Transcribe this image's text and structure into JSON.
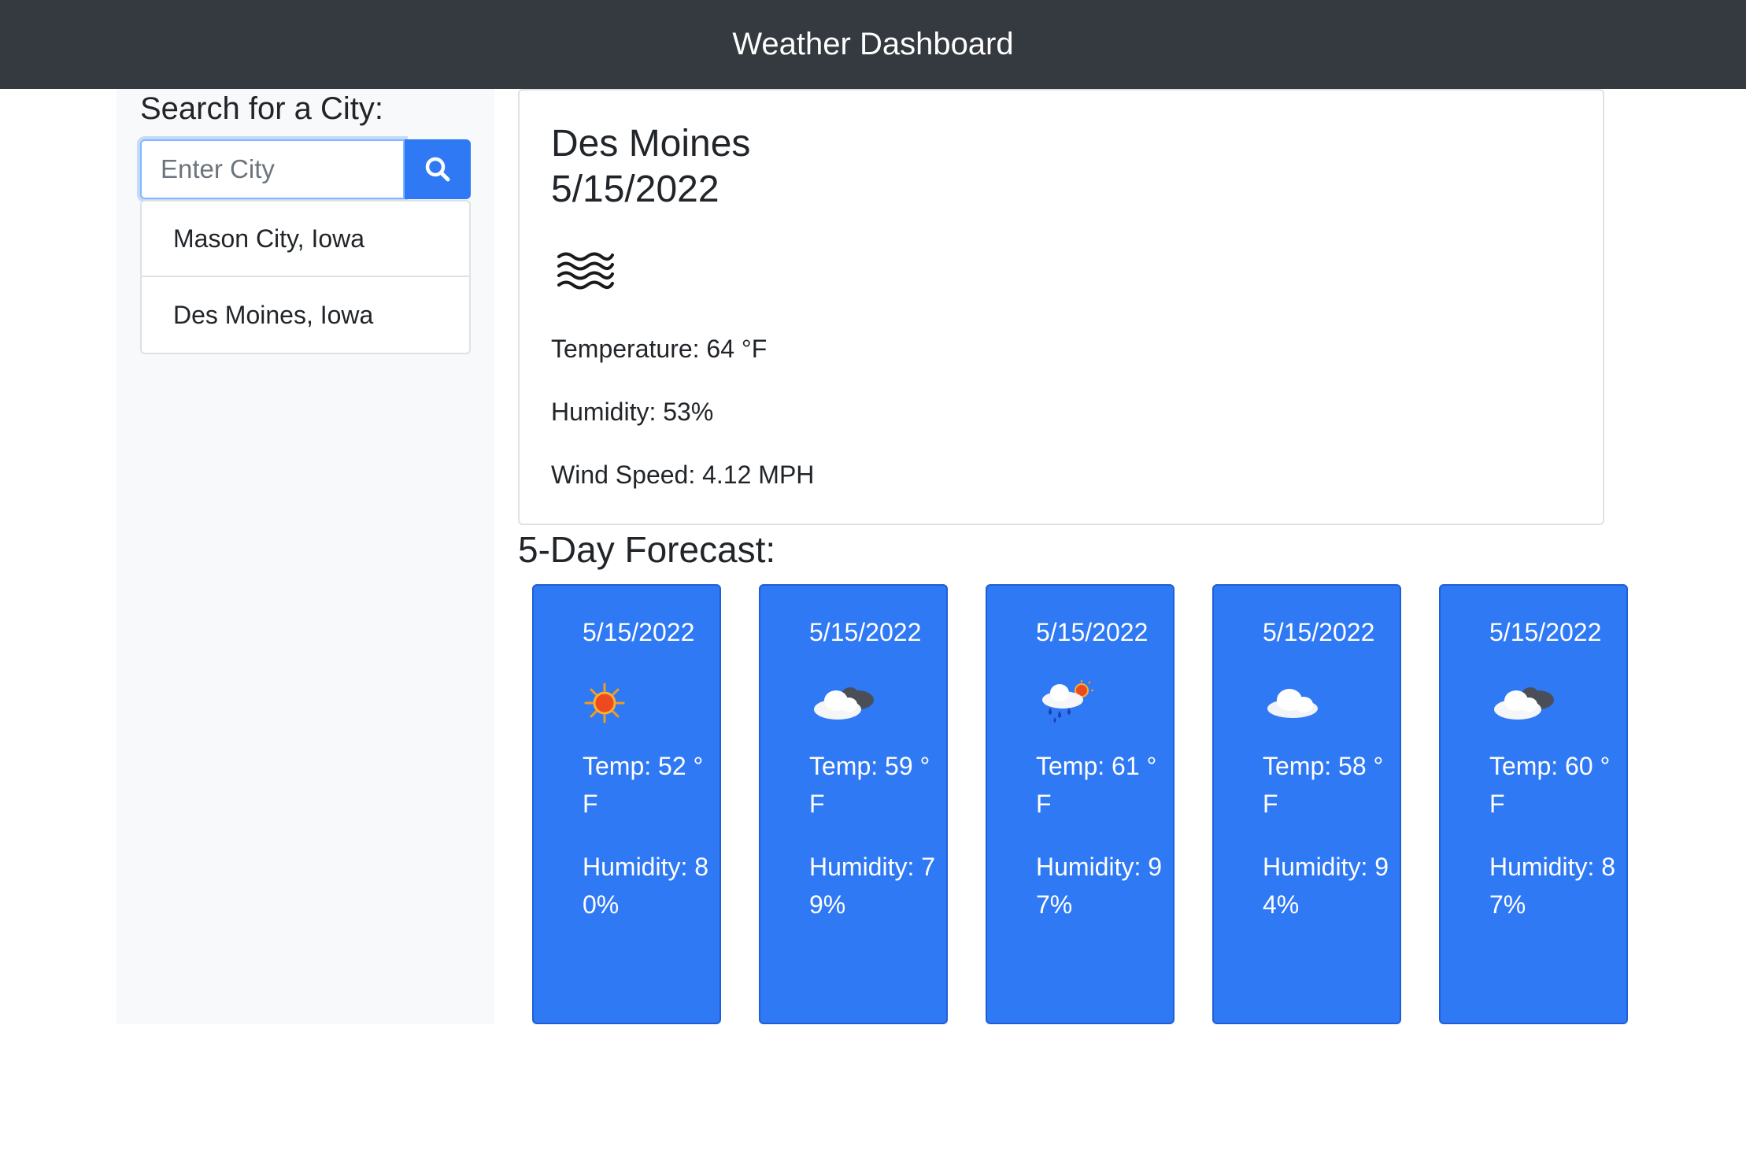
{
  "header": {
    "title": "Weather Dashboard"
  },
  "sidebar": {
    "search_label": "Search for a City:",
    "search_placeholder": "Enter City",
    "search_value": "",
    "search_button_icon": "search-icon",
    "history": [
      "Mason City, Iowa",
      "Des Moines, Iowa"
    ]
  },
  "current": {
    "city": "Des Moines",
    "date": "5/15/2022",
    "icon": "fog-icon",
    "temperature": "Temperature: 64 °F",
    "humidity": "Humidity: 53%",
    "wind": "Wind Speed: 4.12 MPH"
  },
  "forecast": {
    "title": "5-Day Forecast:",
    "days": [
      {
        "date": "5/15/2022",
        "icon": "sun-icon",
        "temp": "Temp: 52 °F",
        "humidity": "Humidity: 80%"
      },
      {
        "date": "5/15/2022",
        "icon": "partly-cloudy-night-icon",
        "temp": "Temp: 59 °F",
        "humidity": "Humidity: 79%"
      },
      {
        "date": "5/15/2022",
        "icon": "rain-sun-icon",
        "temp": "Temp: 61 °F",
        "humidity": "Humidity: 97%"
      },
      {
        "date": "5/15/2022",
        "icon": "cloud-icon",
        "temp": "Temp: 58 °F",
        "humidity": "Humidity: 94%"
      },
      {
        "date": "5/15/2022",
        "icon": "partly-cloudy-night-icon",
        "temp": "Temp: 60 °F",
        "humidity": "Humidity: 87%"
      }
    ]
  },
  "colors": {
    "navbar": "#343a40",
    "accent": "#3079f5",
    "sidebar": "#f8f9fa"
  }
}
